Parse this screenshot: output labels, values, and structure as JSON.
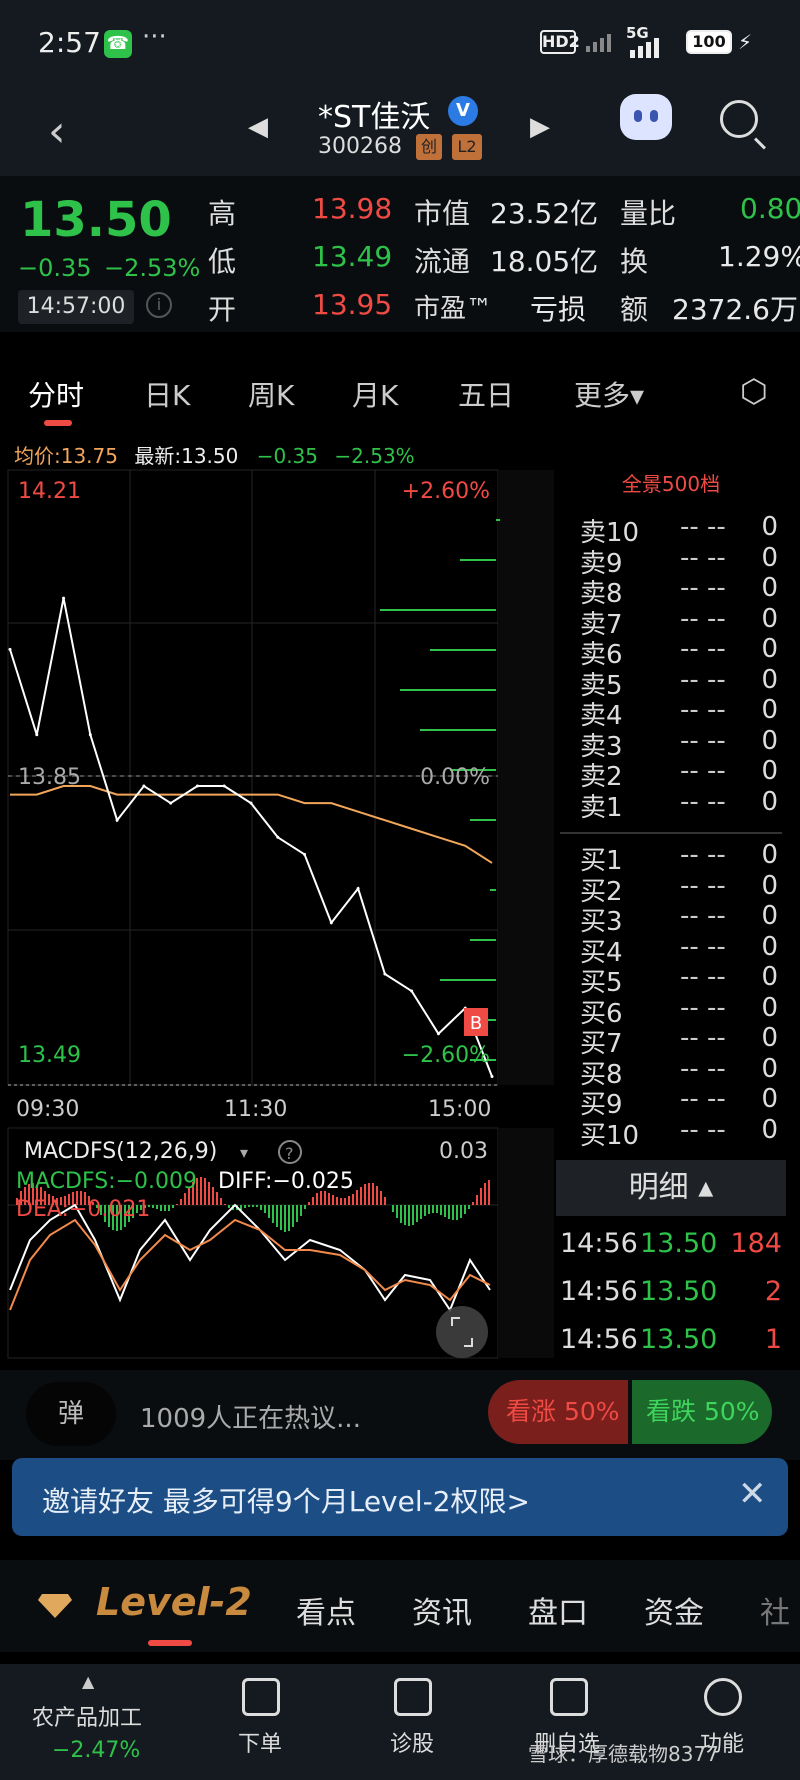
{
  "status_bar": {
    "time": "2:57",
    "call_icon": "phone-icon",
    "more": "···",
    "hd": "HD2",
    "network": "5G",
    "battery": "100"
  },
  "header": {
    "back_icon": "chevron-left-icon",
    "stock_name": "*ST佳沃",
    "verified_icon": "verified-badge-icon",
    "verified_mark": "V",
    "stock_code": "300268",
    "tag_board": "创",
    "tag_level": "L2",
    "prev_icon": "triangle-left-icon",
    "next_icon": "triangle-right-icon",
    "assistant_icon": "robot-icon",
    "search_icon": "search-icon"
  },
  "quote": {
    "price": "13.50",
    "change": "−0.35",
    "change_pct": "−2.53%",
    "time": "14:57:00",
    "high_label": "高",
    "high": "13.98",
    "low_label": "低",
    "low": "13.49",
    "open_label": "开",
    "open": "13.95",
    "mktcap_label": "市值",
    "mktcap": "23.52亿",
    "float_label": "流通",
    "float": "18.05亿",
    "pe_label": "市盈™",
    "pe": "亏损",
    "volratio_label": "量比",
    "volratio": "0.80",
    "turnover_label": "换",
    "turnover": "1.29%",
    "amount_label": "额",
    "amount": "2372.6万"
  },
  "tabs": [
    {
      "label": "分时"
    },
    {
      "label": "日K"
    },
    {
      "label": "周K"
    },
    {
      "label": "月K"
    },
    {
      "label": "五日"
    },
    {
      "label": "更多▾"
    }
  ],
  "legend": {
    "avg": "均价:13.75",
    "latest": "最新:13.50",
    "chg": "−0.35",
    "pct": "−2.53%"
  },
  "chart_labels": {
    "y_top": "14.21",
    "y_mid": "13.85",
    "y_bottom": "13.49",
    "pct_top": "+2.60%",
    "pct_mid": "0.00%",
    "pct_bottom": "−2.60%",
    "x": [
      "09:30",
      "11:30",
      "15:00"
    ],
    "marker": "B"
  },
  "macd": {
    "title": "MACDFS(12,26,9)",
    "top_value": "0.03",
    "macd_line": "MACDFS:−0.009",
    "diff": "DIFF:−0.025",
    "dea": "DEA:−0.021",
    "expand_icon": "expand-icon"
  },
  "orderbook": {
    "title": "全景500档",
    "asks": [
      {
        "n": "卖10",
        "p": "-- --",
        "v": "0"
      },
      {
        "n": "卖9",
        "p": "-- --",
        "v": "0"
      },
      {
        "n": "卖8",
        "p": "-- --",
        "v": "0"
      },
      {
        "n": "卖7",
        "p": "-- --",
        "v": "0"
      },
      {
        "n": "卖6",
        "p": "-- --",
        "v": "0"
      },
      {
        "n": "卖5",
        "p": "-- --",
        "v": "0"
      },
      {
        "n": "卖4",
        "p": "-- --",
        "v": "0"
      },
      {
        "n": "卖3",
        "p": "-- --",
        "v": "0"
      },
      {
        "n": "卖2",
        "p": "-- --",
        "v": "0"
      },
      {
        "n": "卖1",
        "p": "-- --",
        "v": "0"
      }
    ],
    "bids": [
      {
        "n": "买1",
        "p": "-- --",
        "v": "0"
      },
      {
        "n": "买2",
        "p": "-- --",
        "v": "0"
      },
      {
        "n": "买3",
        "p": "-- --",
        "v": "0"
      },
      {
        "n": "买4",
        "p": "-- --",
        "v": "0"
      },
      {
        "n": "买5",
        "p": "-- --",
        "v": "0"
      },
      {
        "n": "买6",
        "p": "-- --",
        "v": "0"
      },
      {
        "n": "买7",
        "p": "-- --",
        "v": "0"
      },
      {
        "n": "买8",
        "p": "-- --",
        "v": "0"
      },
      {
        "n": "买9",
        "p": "-- --",
        "v": "0"
      },
      {
        "n": "买10",
        "p": "-- --",
        "v": "0"
      }
    ],
    "detail_label": "明细 ▴",
    "ticks": [
      {
        "t": "14:56",
        "p": "13.50",
        "v": "184"
      },
      {
        "t": "14:56",
        "p": "13.50",
        "v": "2"
      },
      {
        "t": "14:56",
        "p": "13.50",
        "v": "1"
      }
    ]
  },
  "discussion": {
    "icon_text": "弹",
    "text": "1009人正在热议...",
    "bull": "看涨 50%",
    "bear": "看跌 50%"
  },
  "invite": {
    "text": "邀请好友 最多可得9个月Level-2权限>",
    "close": "✕"
  },
  "section_nav": {
    "gem_icon": "diamond-icon",
    "level2": "Level-2",
    "items": [
      "看点",
      "资讯",
      "盘口",
      "资金",
      "社"
    ]
  },
  "bottom": {
    "industry": "农产品加工",
    "industry_pct": "−2.47%",
    "items": [
      {
        "label": "下单",
        "icon": "order-icon"
      },
      {
        "label": "诊股",
        "icon": "diagnose-icon"
      },
      {
        "label": "删自选",
        "icon": "remove-watch-icon"
      },
      {
        "label": "功能",
        "icon": "menu-icon"
      }
    ],
    "watermark": "雪球：厚德载物8377"
  },
  "colors": {
    "up": "#f04a45",
    "down": "#2fc24a",
    "price_line": "#ffffff",
    "avg_line": "#f2a65a",
    "bg": "#000000"
  },
  "chart_data": {
    "type": "line",
    "title": "",
    "x": [
      "09:30",
      "09:45",
      "10:00",
      "10:15",
      "10:30",
      "10:45",
      "11:00",
      "11:15",
      "11:30",
      "13:15",
      "13:30",
      "13:45",
      "14:00",
      "14:10",
      "14:20",
      "14:30",
      "14:40",
      "14:50",
      "14:57"
    ],
    "series": [
      {
        "name": "最新",
        "values": [
          14.0,
          13.9,
          14.06,
          13.9,
          13.8,
          13.84,
          13.82,
          13.84,
          13.84,
          13.82,
          13.78,
          13.76,
          13.68,
          13.72,
          13.62,
          13.6,
          13.55,
          13.58,
          13.5
        ]
      },
      {
        "name": "均价",
        "values": [
          13.83,
          13.83,
          13.84,
          13.84,
          13.83,
          13.83,
          13.83,
          13.83,
          13.83,
          13.83,
          13.83,
          13.82,
          13.82,
          13.81,
          13.8,
          13.79,
          13.78,
          13.77,
          13.75
        ]
      }
    ],
    "ylim": [
      13.49,
      14.21
    ],
    "grid": true
  }
}
